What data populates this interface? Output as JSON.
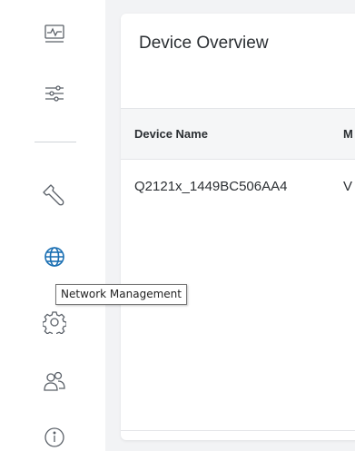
{
  "sidebar": {
    "items": [
      {
        "icon": "dashboard-monitor-icon"
      },
      {
        "icon": "sliders-icon"
      },
      {
        "icon": "wrench-icon"
      },
      {
        "icon": "globe-icon"
      },
      {
        "icon": "gear-icon"
      },
      {
        "icon": "users-icon"
      },
      {
        "icon": "info-icon"
      }
    ],
    "tooltip": "Network Management"
  },
  "panel": {
    "title": "Device Overview",
    "columns": [
      "Device Name",
      "M"
    ],
    "rows": [
      {
        "device_name": "Q2121x_1449BC506AA4",
        "second": "V"
      }
    ]
  },
  "colors": {
    "icon": "#5a6068",
    "accent": "#1a6fb3",
    "background": "#f2f3f5",
    "panel": "#ffffff"
  }
}
